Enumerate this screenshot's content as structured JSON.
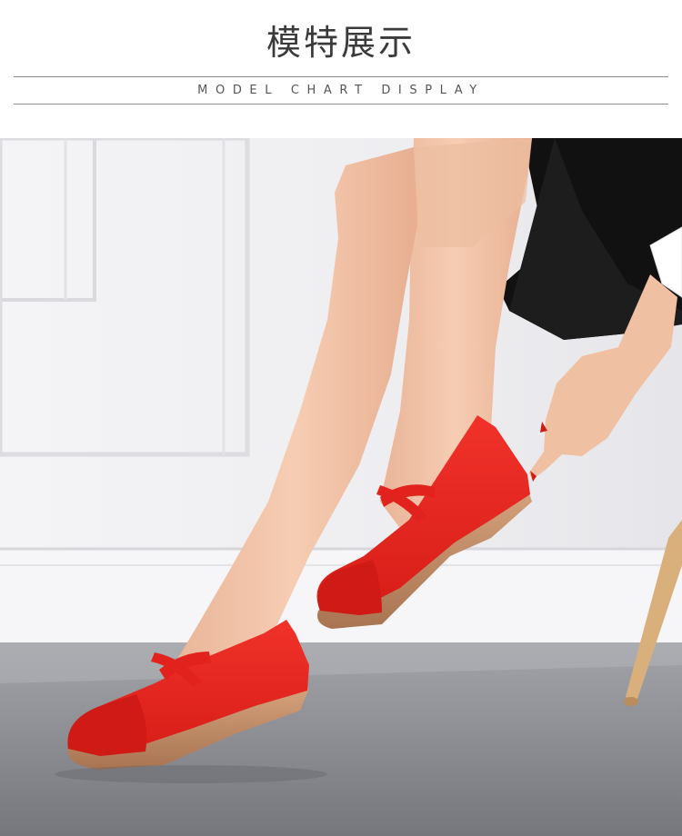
{
  "header": {
    "title": "模特展示",
    "subtitle": "MODEL CHART DISPLAY"
  },
  "photo": {
    "subject": "model-wearing-red-flat-shoes",
    "colors": {
      "shoe": "#e8251f",
      "shoe_toe": "#d41c18",
      "sole": "#c8926a",
      "skin": "#f2c3a6",
      "wall": "#f1f1f3",
      "floor": "#8b8c91",
      "skirt": "#111111",
      "chair_leg": "#d9b07c"
    }
  }
}
